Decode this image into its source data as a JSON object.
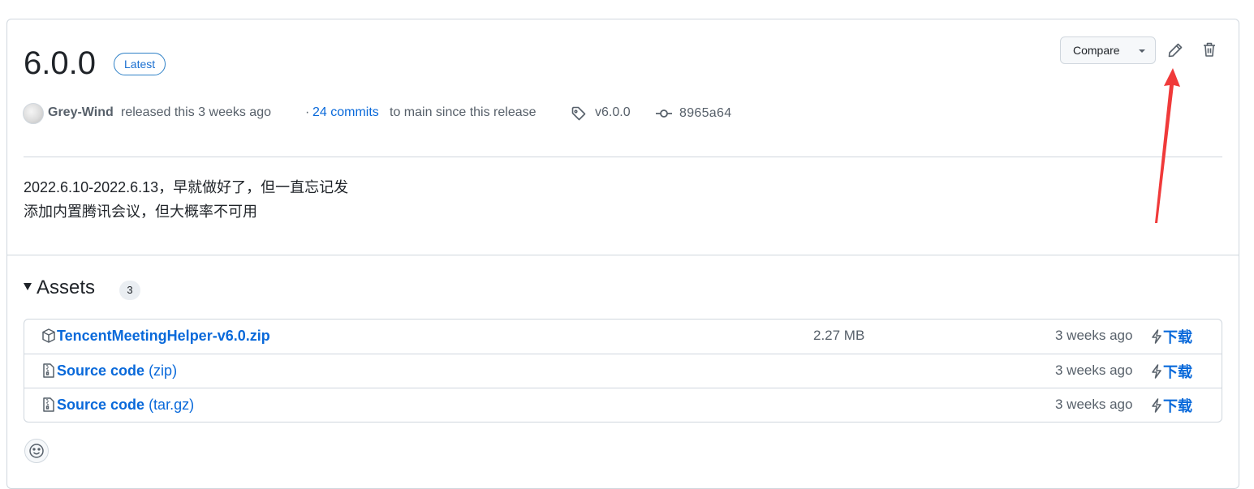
{
  "release": {
    "version": "6.0.0",
    "badge": "Latest",
    "compare_label": "Compare",
    "author": "Grey-Wind",
    "released_text": "released this 3 weeks ago",
    "commits_dot": "·",
    "commits_link": "24 commits",
    "commits_rest": "to main since this release",
    "tag": "v6.0.0",
    "commit_sha": "8965a64",
    "notes": [
      "2022.6.10-2022.6.13，早就做好了，但一直忘记发",
      "添加内置腾讯会议，但大概率不可用"
    ]
  },
  "assets": {
    "title": "Assets",
    "count": "3",
    "rows": [
      {
        "icon": "package-icon",
        "name": "TencentMeetingHelper-v6.0.zip",
        "suffix": "",
        "size": "2.27 MB",
        "date": "3 weeks ago",
        "download": "下载"
      },
      {
        "icon": "file-zip-icon",
        "name": "Source code",
        "suffix": "(zip)",
        "size": "",
        "date": "3 weeks ago",
        "download": "下载"
      },
      {
        "icon": "file-zip-icon",
        "name": "Source code",
        "suffix": "(tar.gz)",
        "size": "",
        "date": "3 weeks ago",
        "download": "下载"
      }
    ]
  },
  "colors": {
    "link": "#0969da",
    "border": "#d0d7de",
    "muted": "#57606a",
    "annotation_arrow": "#f03a3a"
  }
}
